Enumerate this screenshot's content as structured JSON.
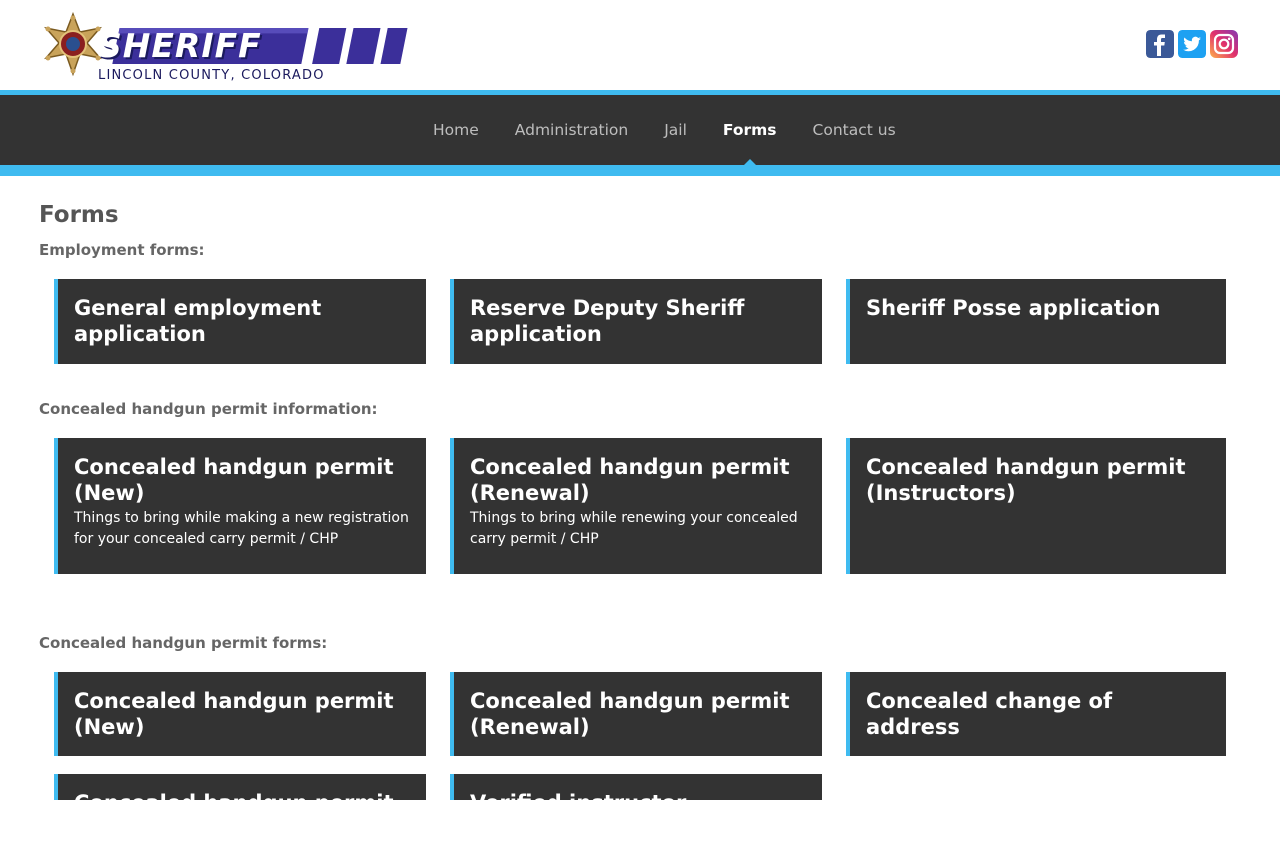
{
  "header": {
    "logo_wordmark": "SHERIFF",
    "logo_county": "LINCOLN COUNTY, COLORADO",
    "social": [
      {
        "icon": "facebook-icon",
        "color": "#3b5998"
      },
      {
        "icon": "twitter-icon",
        "color": "#1da1f2"
      },
      {
        "icon": "instagram-icon",
        "color": "#c13584"
      }
    ]
  },
  "nav": {
    "items": [
      {
        "label": "Home",
        "active": false
      },
      {
        "label": "Administration",
        "active": false
      },
      {
        "label": "Jail",
        "active": false
      },
      {
        "label": "Forms",
        "active": true
      },
      {
        "label": "Contact us",
        "active": false
      }
    ]
  },
  "colors": {
    "accent": "#3fbbf0",
    "nav_bg": "#333333",
    "card_bg": "#333333",
    "text": "#555555"
  },
  "main": {
    "title": "Forms",
    "sections": [
      {
        "label": "Employment forms:",
        "cards": [
          {
            "title": "General employment application"
          },
          {
            "title": "Reserve Deputy Sheriff application"
          },
          {
            "title": "Sheriff Posse application"
          }
        ]
      },
      {
        "label": "Concealed handgun permit information:",
        "cards": [
          {
            "title": "Concealed handgun permit (New)",
            "desc": "Things to bring while making a new registration for your concealed carry permit / CHP"
          },
          {
            "title": "Concealed handgun permit (Renewal)",
            "desc": "Things to bring while renewing your concealed carry permit / CHP"
          },
          {
            "title": "Concealed handgun permit (Instructors)"
          }
        ]
      },
      {
        "label": "Concealed handgun permit forms:",
        "cards": [
          {
            "title": "Concealed handgun permit (New)"
          },
          {
            "title": "Concealed handgun permit (Renewal)"
          },
          {
            "title": "Concealed change of address"
          },
          {
            "title": "Concealed handgun permit"
          },
          {
            "title": "Verified instructor application"
          }
        ]
      }
    ]
  }
}
